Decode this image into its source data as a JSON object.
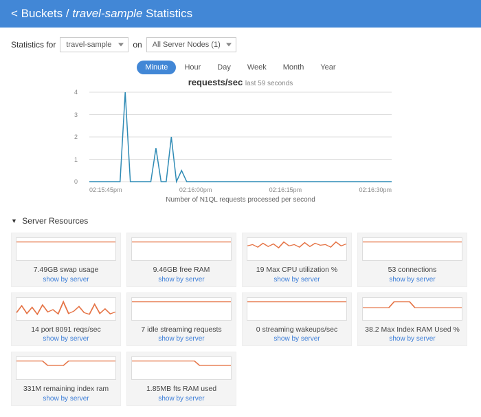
{
  "header": {
    "back_symbol": "<",
    "back_label": "Buckets",
    "sep": "/",
    "bucket_name": "travel-sample",
    "page_word": "Statistics"
  },
  "controls": {
    "stats_for_label": "Statistics for",
    "bucket_selected": "travel-sample",
    "on_label": "on",
    "nodes_selected": "All Server Nodes (1)"
  },
  "time_tabs": {
    "items": [
      "Minute",
      "Hour",
      "Day",
      "Week",
      "Month",
      "Year"
    ],
    "active_index": 0
  },
  "chart_title": {
    "main": "requests/sec",
    "sub": "last 59 seconds"
  },
  "chart_subcaption": "Number of N1QL requests processed per second",
  "chart_data": {
    "type": "line",
    "title": "requests/sec",
    "xlabel": "time",
    "ylabel": "requests/sec",
    "ylim": [
      0,
      4
    ],
    "x_tick_labels": [
      "02:15:45pm",
      "02:16:00pm",
      "02:16:15pm",
      "02:16:30pm"
    ],
    "y_tick_labels": [
      "0",
      "1",
      "2",
      "3",
      "4"
    ],
    "series": [
      {
        "name": "N1QL requests/sec",
        "values": [
          0,
          0,
          0,
          0,
          0,
          0,
          0,
          4,
          0,
          0,
          0,
          0,
          0,
          1.5,
          0,
          0,
          2,
          0,
          0.5,
          0,
          0,
          0,
          0,
          0,
          0,
          0,
          0,
          0,
          0,
          0,
          0,
          0,
          0,
          0,
          0,
          0,
          0,
          0,
          0,
          0,
          0,
          0,
          0,
          0,
          0,
          0,
          0,
          0,
          0,
          0,
          0,
          0,
          0,
          0,
          0,
          0,
          0,
          0,
          0,
          0
        ]
      }
    ]
  },
  "section": {
    "server_resources": "Server Resources"
  },
  "show_by_server": "show by server",
  "cards": [
    {
      "label": "7.49GB swap usage",
      "spark": [
        10,
        10,
        10,
        10,
        10,
        10,
        10,
        10,
        10,
        10,
        10,
        10,
        10,
        10,
        10,
        10,
        10,
        10,
        10,
        10
      ]
    },
    {
      "label": "9.46GB free RAM",
      "spark": [
        10,
        10,
        10,
        10,
        10,
        10,
        10,
        10,
        10,
        10,
        10,
        10,
        10,
        10,
        10,
        10,
        10,
        10,
        10,
        10
      ]
    },
    {
      "label": "19 Max CPU utilization %",
      "spark": [
        18,
        20,
        16,
        22,
        17,
        21,
        15,
        24,
        18,
        20,
        16,
        23,
        17,
        22,
        19,
        20,
        16,
        24,
        18,
        21
      ]
    },
    {
      "label": "53 connections",
      "spark": [
        10,
        10,
        10,
        10,
        10,
        10,
        10,
        10,
        10,
        10,
        10,
        10,
        10,
        10,
        10,
        10,
        10,
        10,
        10,
        10
      ]
    },
    {
      "label": "14 port 8091 reqs/sec",
      "spark": [
        12,
        30,
        10,
        26,
        8,
        32,
        14,
        20,
        9,
        40,
        10,
        16,
        28,
        12,
        8,
        34,
        10,
        22,
        9,
        14
      ]
    },
    {
      "label": "7 idle streaming requests",
      "spark": [
        10,
        10,
        10,
        10,
        10,
        10,
        10,
        10,
        10,
        10,
        10,
        10,
        10,
        10,
        10,
        10,
        10,
        10,
        10,
        10
      ]
    },
    {
      "label": "0 streaming wakeups/sec",
      "spark": [
        10,
        10,
        10,
        10,
        10,
        10,
        10,
        10,
        10,
        10,
        10,
        10,
        10,
        10,
        10,
        10,
        10,
        10,
        10,
        10
      ]
    },
    {
      "label": "38.2 Max Index RAM Used %",
      "spark": [
        10,
        10,
        10,
        10,
        10,
        10,
        16,
        16,
        16,
        16,
        10,
        10,
        10,
        10,
        10,
        10,
        10,
        10,
        10,
        10
      ]
    },
    {
      "label": "331M remaining index ram",
      "spark": [
        14,
        14,
        14,
        14,
        14,
        14,
        10,
        10,
        10,
        10,
        14,
        14,
        14,
        14,
        14,
        14,
        14,
        14,
        14,
        14
      ]
    },
    {
      "label": "1.85MB fts RAM used",
      "spark": [
        14,
        14,
        14,
        14,
        14,
        14,
        14,
        14,
        14,
        14,
        14,
        14,
        14,
        10,
        10,
        10,
        10,
        10,
        10,
        10
      ]
    }
  ],
  "colors": {
    "accent": "#4287d6",
    "spark": "#e57345",
    "line": "#2f8bb5"
  }
}
